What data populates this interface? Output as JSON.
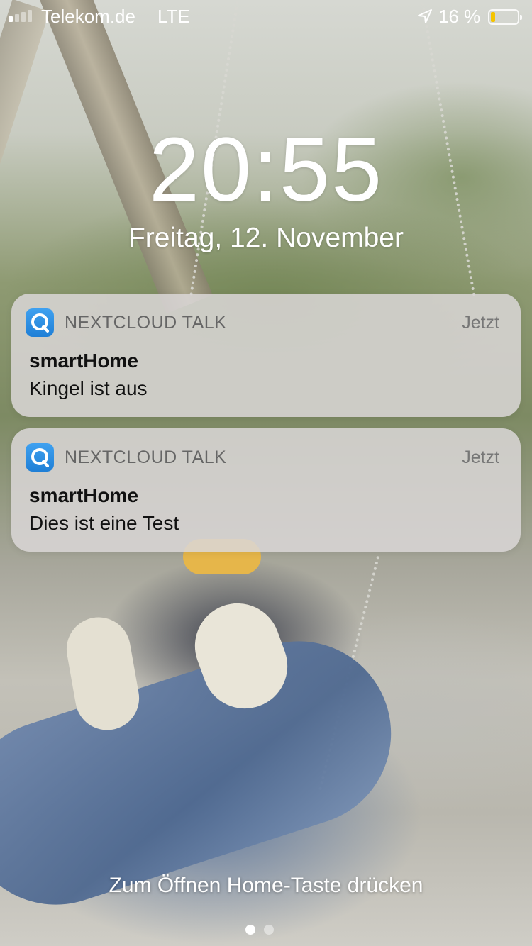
{
  "status_bar": {
    "carrier": "Telekom.de",
    "network": "LTE",
    "battery_percent_label": "16 %",
    "battery_level": 0.16,
    "signal_bars": 1,
    "location_icon": "location-arrow-icon"
  },
  "lockscreen": {
    "time": "20:55",
    "date": "Freitag, 12. November",
    "unlock_hint": "Zum Öffnen Home-Taste drücken"
  },
  "notifications": [
    {
      "app_name": "NEXTCLOUD TALK",
      "app_icon": "nextcloud-talk-icon",
      "time": "Jetzt",
      "title": "smartHome",
      "body": "Kingel ist aus"
    },
    {
      "app_name": "NEXTCLOUD TALK",
      "app_icon": "nextcloud-talk-icon",
      "time": "Jetzt",
      "title": "smartHome",
      "body": "Dies ist eine Test"
    }
  ],
  "page_indicator": {
    "pages": 2,
    "active": 0
  },
  "colors": {
    "battery_fill": "#f5c400",
    "app_icon": "#2b8de6"
  }
}
